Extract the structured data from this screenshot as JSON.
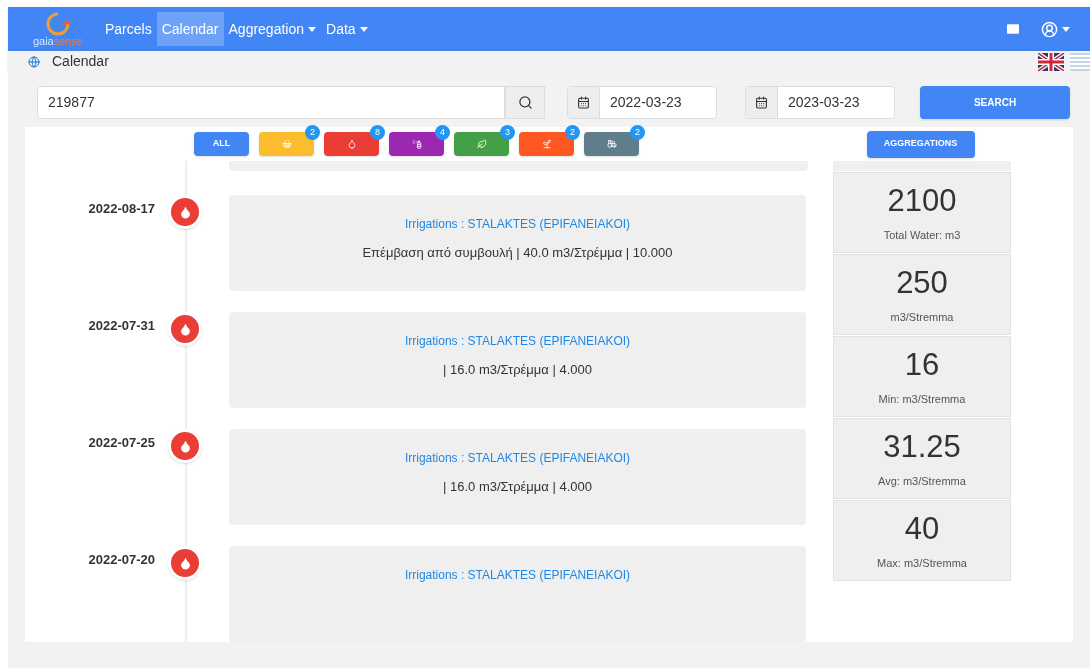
{
  "logo": {
    "first": "gaia",
    "second": "sense"
  },
  "nav": [
    {
      "label": "Parcels",
      "selected": false,
      "dropdown": false
    },
    {
      "label": "Calendar",
      "selected": true,
      "dropdown": false
    },
    {
      "label": "Aggregation",
      "selected": false,
      "dropdown": true
    },
    {
      "label": "Data",
      "selected": false,
      "dropdown": true
    }
  ],
  "breadcrumb": "Calendar",
  "search": {
    "parcel": "219877",
    "from": "2022-03-23",
    "to": "2023-03-23",
    "button": "SEARCH"
  },
  "filters": [
    {
      "kind": "all",
      "label": "ALL",
      "color": "#4285f4"
    },
    {
      "kind": "basket",
      "count": "2",
      "color": "#fbbc2e"
    },
    {
      "kind": "drop",
      "count": "8",
      "color": "#ea3d36"
    },
    {
      "kind": "spray",
      "count": "4",
      "color": "#9c27b0"
    },
    {
      "kind": "leaf",
      "count": "3",
      "color": "#43a047"
    },
    {
      "kind": "sprout",
      "count": "2",
      "color": "#ff5722"
    },
    {
      "kind": "tractor",
      "count": "2",
      "color": "#607d8b"
    }
  ],
  "aggregations_button": "AGGREGATIONS",
  "events": [
    {
      "date": "2022-08-17",
      "kind": "drop",
      "title": "Irrigations : STALAKTES (EPIFANEIAKOI)",
      "detail": "Επέμβαση από συμβουλή | 40.0 m3/Στρέμμα | 10.000"
    },
    {
      "date": "2022-07-31",
      "kind": "drop",
      "title": "Irrigations : STALAKTES (EPIFANEIAKOI)",
      "detail": "| 16.0 m3/Στρέμμα | 4.000"
    },
    {
      "date": "2022-07-25",
      "kind": "drop",
      "title": "Irrigations : STALAKTES (EPIFANEIAKOI)",
      "detail": "| 16.0 m3/Στρέμμα | 4.000"
    },
    {
      "date": "2022-07-20",
      "kind": "drop",
      "title": "Irrigations : STALAKTES (EPIFANEIAKOI)"
    }
  ],
  "stats": [
    {
      "value": "2100",
      "label": "Total Water: m3"
    },
    {
      "value": "250",
      "label": "m3/Stremma"
    },
    {
      "value": "16",
      "label": "Min: m3/Stremma"
    },
    {
      "value": "31.25",
      "label": "Avg: m3/Stremma"
    },
    {
      "value": "40",
      "label": "Max: m3/Stremma"
    }
  ]
}
